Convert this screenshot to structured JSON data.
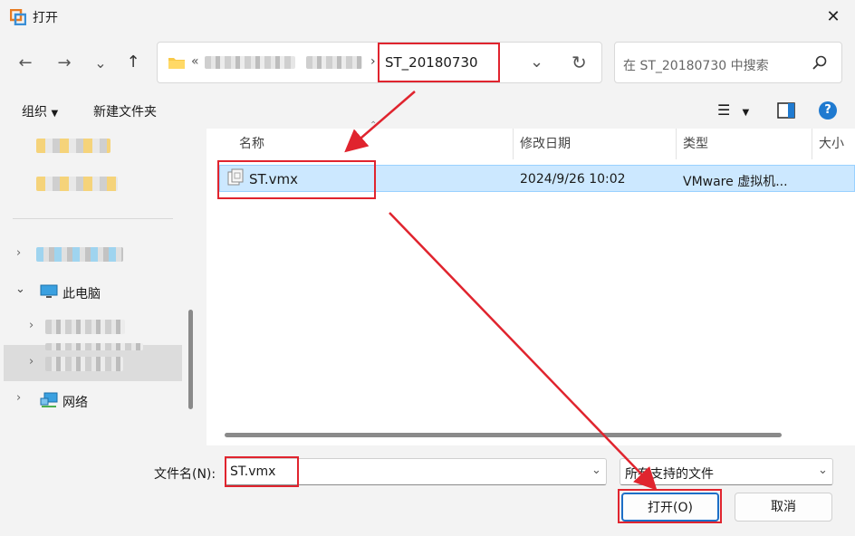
{
  "window": {
    "title": "打开"
  },
  "nav": {
    "back": "←",
    "forward": "→",
    "recent": "⌄",
    "up": "↑"
  },
  "address": {
    "prefix": "«",
    "current": "ST_20180730",
    "separator": "›",
    "dropdown": "⌄",
    "refresh": "↻"
  },
  "search": {
    "placeholder": "在 ST_20180730 中搜索"
  },
  "toolbar": {
    "organize": "组织",
    "new_folder": "新建文件夹"
  },
  "sidebar": {
    "this_pc": "此电脑",
    "network": "网络"
  },
  "columns": {
    "name": "名称",
    "modified": "修改日期",
    "type": "类型",
    "size": "大小"
  },
  "files": [
    {
      "name": "ST.vmx",
      "modified": "2024/9/26 10:02",
      "type": "VMware 虚拟机..."
    }
  ],
  "footer": {
    "filename_label": "文件名(N):",
    "filename_value": "ST.vmx",
    "filetype": "所有支持的文件",
    "open_button": "打开(O)",
    "cancel_button": "取消"
  },
  "colors": {
    "annotation": "#e0242e",
    "selection": "#cce8ff",
    "accent": "#1d6fc7"
  }
}
